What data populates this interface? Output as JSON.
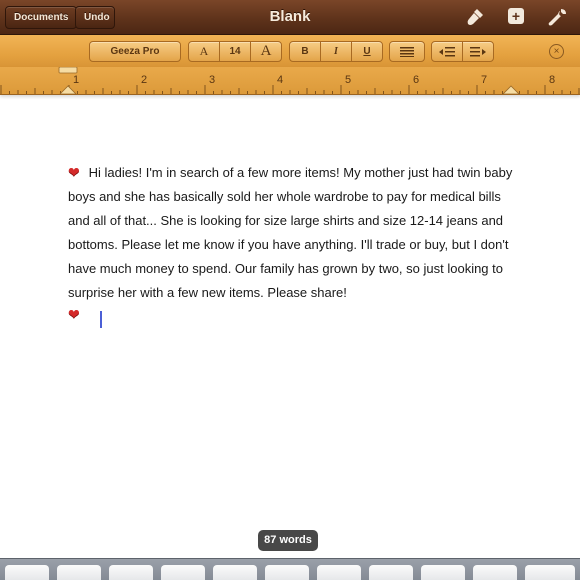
{
  "titlebar": {
    "documents_label": "Documents",
    "undo_label": "Undo",
    "title": "Blank",
    "icons": [
      "brush-icon",
      "add-icon",
      "wrench-icon"
    ]
  },
  "formatbar": {
    "font_name": "Geeza Pro",
    "font_decrease": "A",
    "font_size": "14",
    "font_increase": "A",
    "bold": "B",
    "italic": "I",
    "underline": "U",
    "close": "×"
  },
  "ruler": {
    "numbers": [
      "1",
      "2",
      "3",
      "4",
      "5",
      "6",
      "7",
      "8"
    ]
  },
  "document": {
    "text": "Hi ladies! I'm in search of a few more items! My mother just had twin baby boys and she has basically sold her whole wardrobe to pay for medical bills and all of that... She is looking for size large shirts and size 12-14 jeans and bottoms. Please let me know if you have anything. I'll trade or buy, but I don't have much money to spend. Our family has grown by two, so just looking to surprise her with a few new items. Please share!",
    "heart_glyph": "❤"
  },
  "status": {
    "word_count": "87 words"
  },
  "colors": {
    "titlebar": "#5f331b",
    "formatbar": "#e5a240",
    "caret": "#4b5fd6",
    "heart": "#d42a2a"
  }
}
